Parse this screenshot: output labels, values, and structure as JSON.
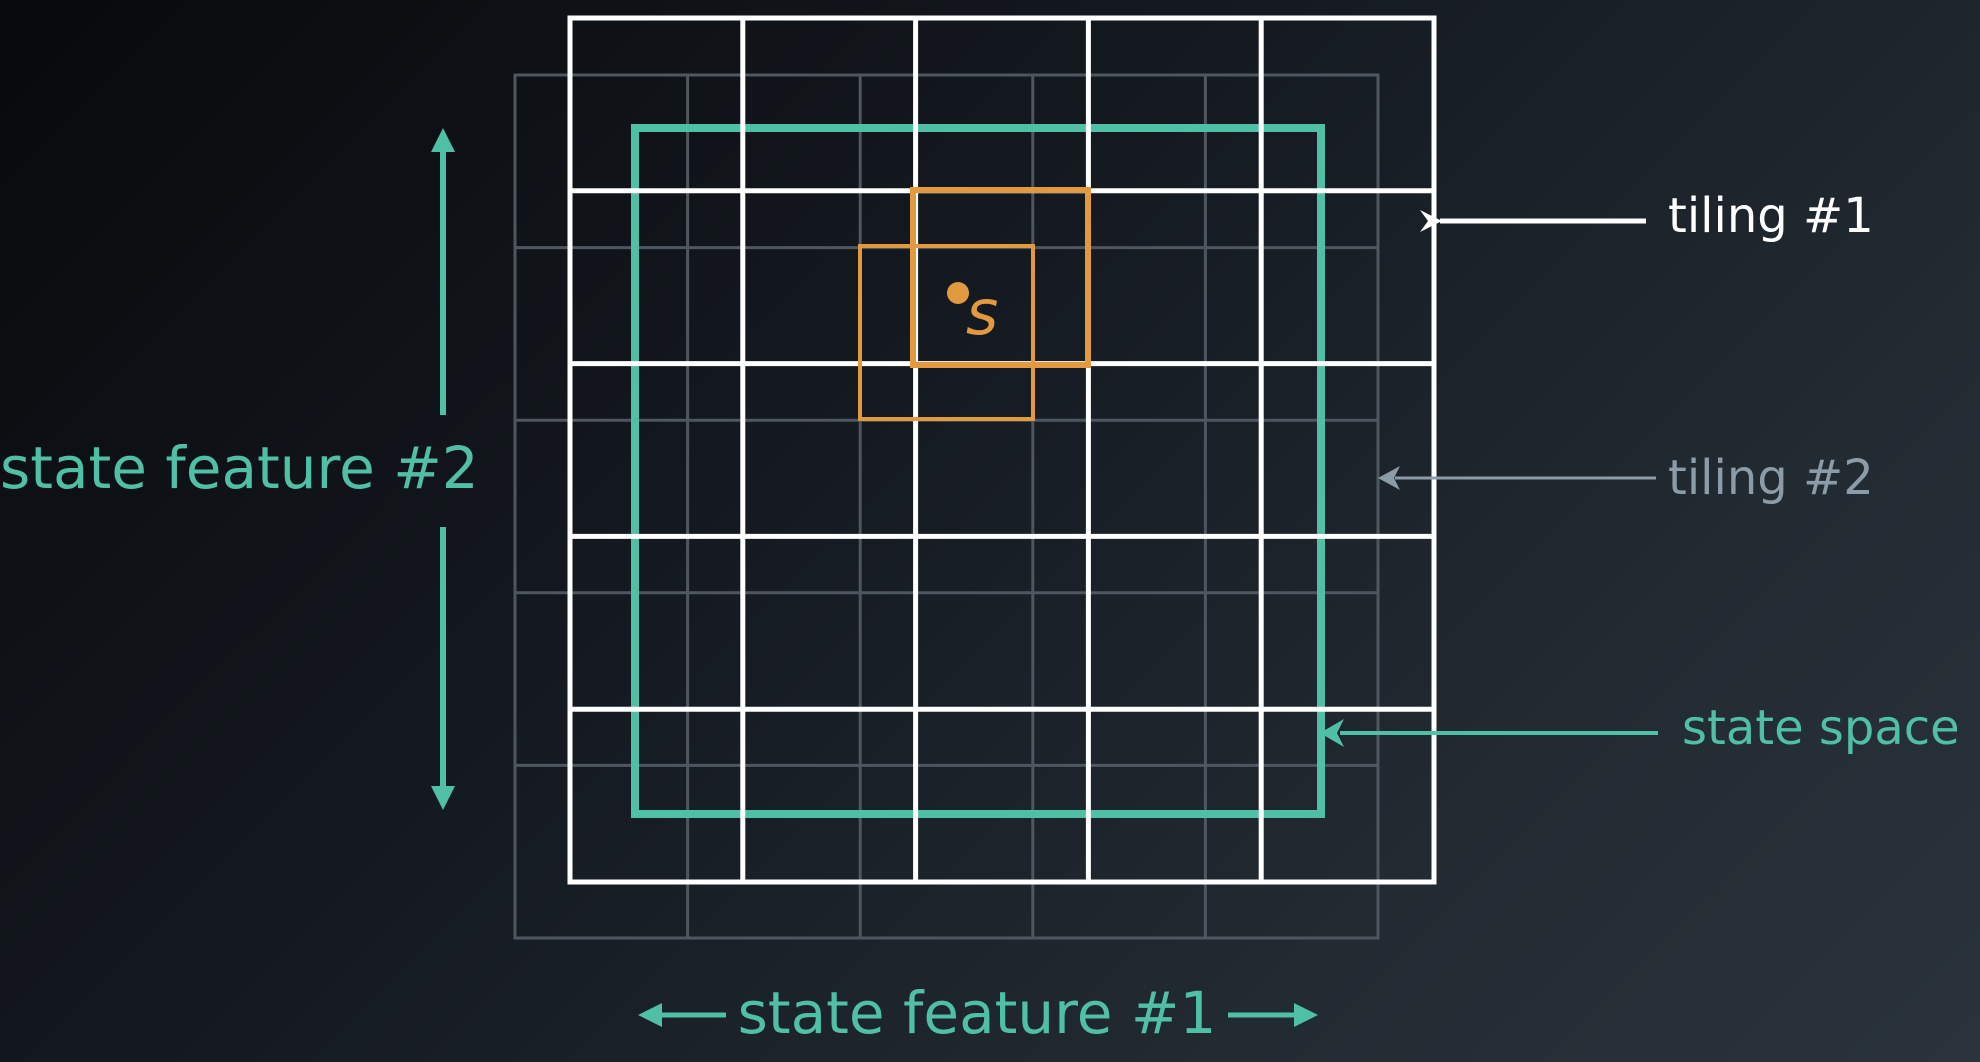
{
  "labels": {
    "tiling_1": "tiling #1",
    "tiling_2": "tiling #2",
    "state_space": "state space",
    "state_feature_1": "state feature #1",
    "state_feature_2": "state feature #2",
    "state_symbol": "s"
  },
  "diagram": {
    "grid_rows": 5,
    "grid_cols": 5
  },
  "colors": {
    "tiling_1": "#ffffff",
    "tiling_2": "#4e5760",
    "tiling_2_label": "#8c9ba8",
    "state_space": "#4fbfa6",
    "active_tile": "#e39a3f"
  }
}
